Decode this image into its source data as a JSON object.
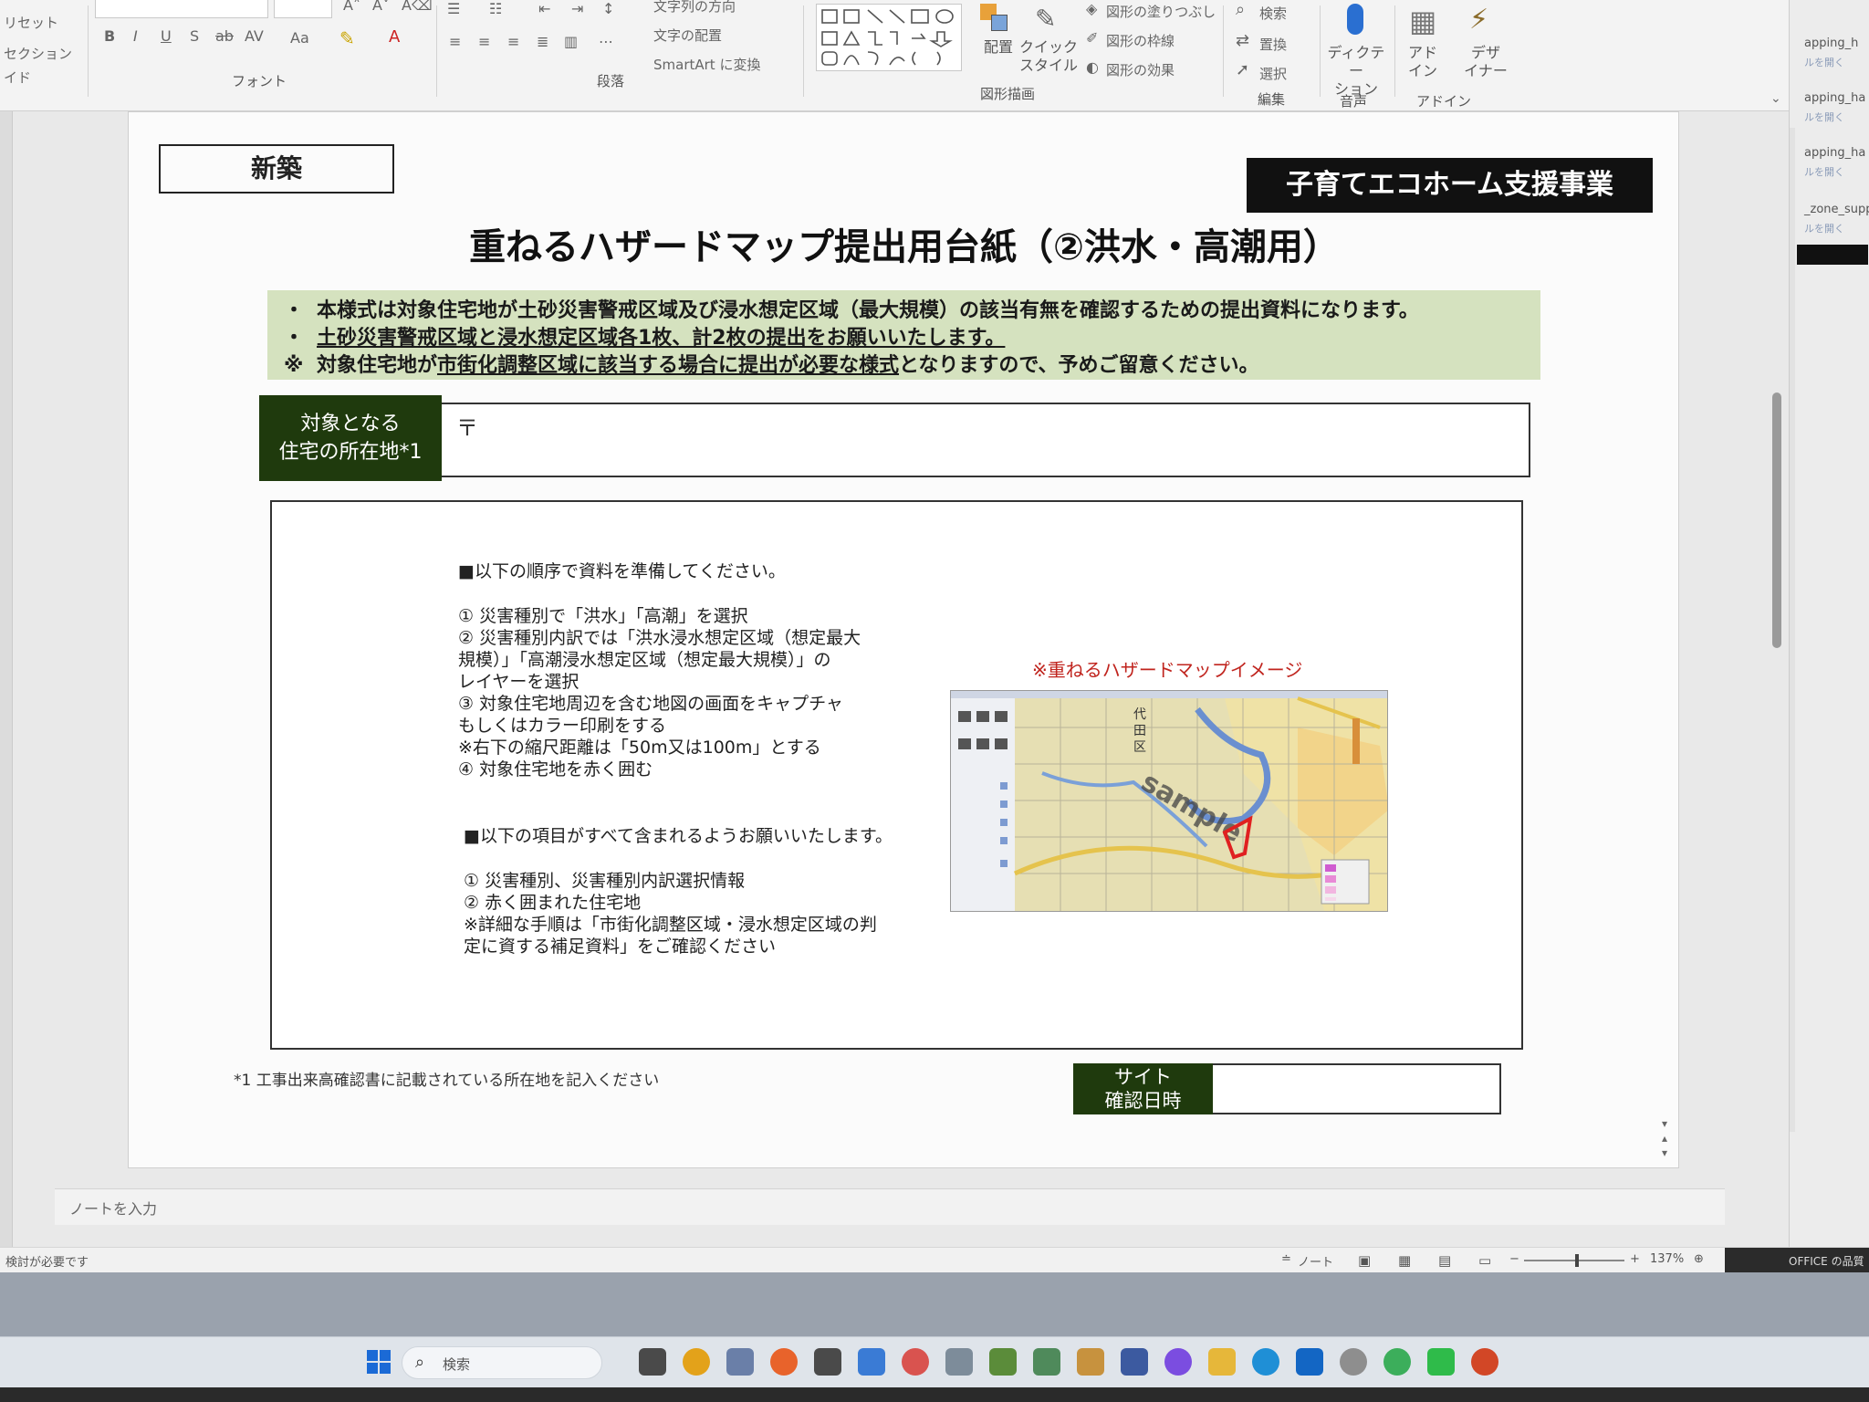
{
  "ribbon": {
    "left": {
      "reset": "リセット",
      "section": "セクション",
      "layout_frag": "イド"
    },
    "font_group": "フォント",
    "paragraph_group": "段落",
    "text_direction": "文字列の方向",
    "align_text": "文字の配置",
    "smartart": "SmartArt に変換",
    "drawing_group": "図形描画",
    "arrange": "配置",
    "quick_style": "クイック\nスタイル",
    "shape_fill": "図形の塗りつぶし",
    "shape_outline": "図形の枠線",
    "shape_effects": "図形の効果",
    "find": "検索",
    "replace": "置換",
    "select": "選択",
    "editing_group": "編集",
    "dictation": "ディクテー\nション",
    "voice_group": "音声",
    "addins": "アド\nイン",
    "addins_group": "アドイン",
    "designer": "デザ\nイナー",
    "font_buttons": [
      "B",
      "I",
      "U",
      "S",
      "ab",
      "AV",
      "Aa",
      "A"
    ]
  },
  "side_panel": [
    {
      "label": "apping_h",
      "sub": "ルを開く"
    },
    {
      "label": "apping_ha",
      "sub": "ルを開く"
    },
    {
      "label": "apping_ha",
      "sub": "ルを開く"
    },
    {
      "label": "_zone_supp",
      "sub": "ルを開く"
    }
  ],
  "slide": {
    "new_label": "新築",
    "brand": "子育てエコホーム支援事業",
    "title": "重ねるハザードマップ提出用台紙（②洪水・高潮用）",
    "notice": [
      {
        "mark": "・",
        "pre": "本様式は対象住宅地が土砂災害警戒区域及び浸水想定区域（最大規模）の該当有無を確認するための提出資料になります。",
        "u": "",
        "post": ""
      },
      {
        "mark": "・",
        "pre": "",
        "u": "土砂災害警戒区域と浸水想定区域各1枚、計2枚の提出をお願いいたします。",
        "post": ""
      },
      {
        "mark": "※",
        "pre": "対象住宅地が",
        "u": "市街化調整区域に該当する場合に提出が必要な様式",
        "post": "となりますので、予めご留意ください。"
      }
    ],
    "address_label": "対象となる\n住宅の所在地*1",
    "postal_mark": "〒",
    "instructions": {
      "heading1": "■以下の順序で資料を準備してください。",
      "steps": [
        "①  災害種別で「洪水」「高潮」を選択",
        "②  災害種別内訳では「洪水浸水想定区域（想定最大",
        "      規模）」「高潮浸水想定区域（想定最大規模）」の",
        "      レイヤーを選択",
        "③  対象住宅地周辺を含む地図の画面をキャプチャ",
        "      もしくはカラー印刷をする",
        "      ※右下の縮尺距離は「50m又は100m」とする",
        "④  対象住宅地を赤く囲む"
      ],
      "heading2": "■以下の項目がすべて含まれるようお願いいたします。",
      "items": [
        "①  災害種別、災害種別内訳選択情報",
        "②  赤く囲まれた住宅地",
        "※詳細な手順は「市街化調整区域・浸水想定区域の判",
        "定に資する補足資料」をご確認ください"
      ]
    },
    "map_caption": "※重ねるハザードマップイメージ",
    "map_watermark": "sample",
    "map_labels": {
      "district_1": "代",
      "district_2": "田",
      "district_3": "区"
    },
    "footnote": "*1  工事出来高確認書に記載されている所在地を記入ください",
    "site_label": "サイト\n確認日時"
  },
  "notes_placeholder": "ノートを入力",
  "status": {
    "left": "検討が必要です",
    "notes": "ノート",
    "zoom": "137%",
    "office": "OFFICE の品質"
  },
  "taskbar": {
    "search_placeholder": "検索",
    "icons": [
      {
        "name": "windows",
        "color": "#1b6ad6"
      },
      {
        "name": "chrome",
        "color": "#e3a21a"
      },
      {
        "name": "files",
        "color": "#6a7fa8"
      },
      {
        "name": "firefox",
        "color": "#e8632b"
      },
      {
        "name": "app-a",
        "color": "#4a4a4a"
      },
      {
        "name": "app-b",
        "color": "#3a7bd5"
      },
      {
        "name": "app-c",
        "color": "#d9534f"
      },
      {
        "name": "app-d",
        "color": "#7d8c9a"
      },
      {
        "name": "app-e",
        "color": "#5b8c3a"
      },
      {
        "name": "app-f",
        "color": "#4f8a5b"
      },
      {
        "name": "app-g",
        "color": "#c7923e"
      },
      {
        "name": "app-h",
        "color": "#3c5aa0"
      },
      {
        "name": "messenger",
        "color": "#7b4de0"
      },
      {
        "name": "explorer",
        "color": "#e6b73a"
      },
      {
        "name": "edge",
        "color": "#1f8fd6"
      },
      {
        "name": "outlook",
        "color": "#1366c4"
      },
      {
        "name": "music",
        "color": "#8e8e8e"
      },
      {
        "name": "app-i",
        "color": "#3cae5b"
      },
      {
        "name": "line",
        "color": "#2fbb4a"
      },
      {
        "name": "powerpoint",
        "color": "#d24726"
      }
    ]
  },
  "colors": {
    "label_green": "#1f3a0d",
    "notice_bg": "#d5e2bf",
    "brand_bg": "#111111",
    "caption_red": "#c0241e"
  }
}
